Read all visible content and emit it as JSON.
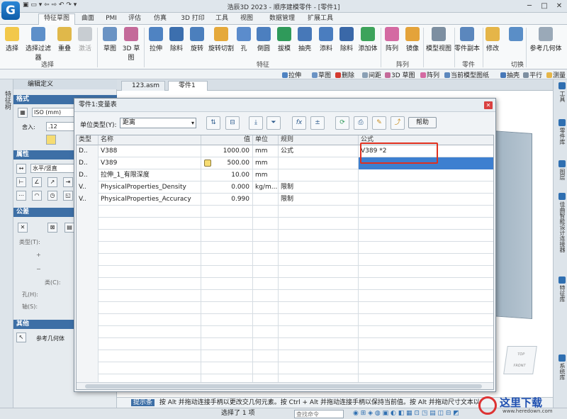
{
  "app": {
    "title": "浩辰3D 2023 - 顺序建模零件 - [零件1]",
    "logo_letter": "G"
  },
  "ribbon_tabs": [
    "特征草图",
    "曲面",
    "PMI",
    "评估",
    "仿真",
    "3D 打印",
    "工具",
    "视图",
    "数据管理",
    "扩展工具"
  ],
  "ribbon": {
    "select": {
      "buttons": [
        "选择",
        "选择过滤器",
        "重叠",
        "激活"
      ],
      "group": "选择"
    },
    "sketch": {
      "buttons": [
        "草图",
        "3D 草图"
      ]
    },
    "features": {
      "buttons": [
        "拉伸",
        "除料",
        "旋转",
        "旋转切割",
        "孔",
        "倒圆",
        "拔模",
        "抽壳",
        "添料",
        "除料",
        "添加体"
      ],
      "group": "特征"
    },
    "pattern": {
      "buttons": [
        "阵列",
        "镜像"
      ],
      "group": "阵列"
    },
    "model_view": {
      "buttons": [
        "模型视图"
      ]
    },
    "part_copy": {
      "buttons": [
        "零件副本"
      ],
      "group": "零件"
    },
    "modify": {
      "buttons": [
        "修改"
      ],
      "group": "切换"
    },
    "ref_geom": {
      "buttons": [
        "参考几何体"
      ]
    }
  },
  "feature_toolbar": [
    "拉伸",
    "草图",
    "删除",
    "间距",
    "3D 草图",
    "阵列",
    "当前模型图纸",
    "抽壳",
    "平行",
    "测量"
  ],
  "left_strip": {
    "label": "特征树"
  },
  "edit_panel": {
    "title": "编辑定义",
    "format": {
      "header": "格式",
      "standard": "ISO (mm)",
      "round_label": "舍入:",
      "round_value": ".12"
    },
    "attributes": {
      "header": "属性",
      "orientation": "水平/竖直"
    },
    "tolerance": {
      "header": "公差",
      "type_label": "类型(T):",
      "class_label": "类(C):",
      "hole_label": "孔(H):",
      "shaft_label": "轴(S):"
    },
    "other": {
      "header": "其他",
      "ref_geom": "参考几何体"
    }
  },
  "doc_tabs": [
    {
      "label": "123.asm"
    },
    {
      "label": "零件1"
    }
  ],
  "right_strip": [
    "工具",
    "零件库",
    "图层",
    "佳曲智能设计连接器",
    "特征库",
    "系统库"
  ],
  "dialog": {
    "title": "零件1:变量表",
    "unit_type_label": "单位类型(Y):",
    "unit_type_value": "距离",
    "help_label": "帮助",
    "columns": [
      "类型",
      "名称",
      "值",
      "单位",
      "规则",
      "公式"
    ],
    "rows": [
      {
        "type": "D..",
        "name": "V388",
        "value": "1000.00",
        "unit": "mm",
        "rule": "公式",
        "formula": "V389 *2",
        "locked": false,
        "selected": false
      },
      {
        "type": "D..",
        "name": "V389",
        "value": "500.00",
        "unit": "mm",
        "rule": "",
        "formula": "",
        "locked": true,
        "selected": true
      },
      {
        "type": "D..",
        "name": "拉伸_1_有限深度",
        "value": "10.00",
        "unit": "mm",
        "rule": "",
        "formula": "",
        "locked": false,
        "selected": false
      },
      {
        "type": "V..",
        "name": "PhysicalProperties_Density",
        "value": "0.000",
        "unit": "kg/m...",
        "rule": "限制",
        "formula": "",
        "locked": false,
        "selected": false
      },
      {
        "type": "V..",
        "name": "PhysicalProperties_Accuracy",
        "value": "0.990",
        "unit": "",
        "rule": "限制",
        "formula": "",
        "locked": false,
        "selected": false
      }
    ]
  },
  "hint_bar": {
    "tag": "提示条",
    "text": "按 Alt 并拖动连接手柄以更改交几何元素。按 Ctrl + Alt 并拖动连接手柄以保持当前值。按 Alt 并拖动尺寸文本以"
  },
  "status_bar": {
    "selection": "选择了 1 项",
    "search_placeholder": "查找命令"
  },
  "view_cube": {
    "top": "TOP",
    "front": "FRONT"
  },
  "watermark": {
    "text": "这里下载",
    "url": "www.heredown.com"
  }
}
